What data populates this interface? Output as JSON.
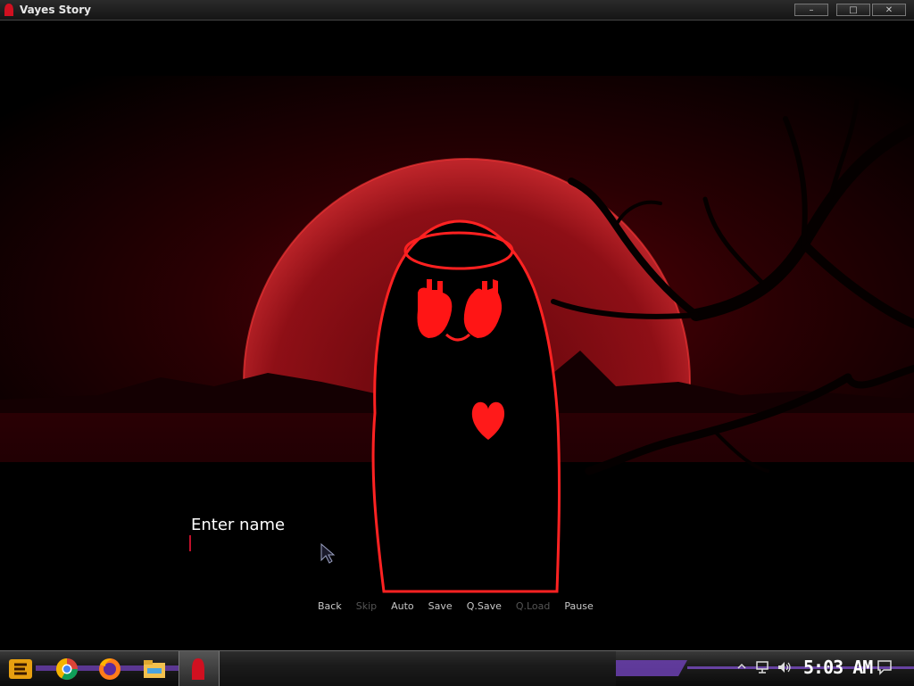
{
  "window": {
    "title": "Vayes Story",
    "minimize_label": "–",
    "maximize_label": "□",
    "close_label": "✕"
  },
  "game": {
    "prompt": "Enter name",
    "name_value": "",
    "quick_menu": [
      {
        "label": "Back",
        "enabled": true
      },
      {
        "label": "Skip",
        "enabled": false
      },
      {
        "label": "Auto",
        "enabled": true
      },
      {
        "label": "Save",
        "enabled": true
      },
      {
        "label": "Q.Save",
        "enabled": true
      },
      {
        "label": "Q.Load",
        "enabled": false
      },
      {
        "label": "Pause",
        "enabled": true
      }
    ]
  },
  "taskbar": {
    "items": [
      "start-menu-icon",
      "chrome-icon",
      "firefox-icon",
      "file-explorer-icon",
      "vayes-story-app-icon"
    ],
    "tray_icons": [
      "show-hidden-icons-chevron",
      "network-icon",
      "volume-icon",
      "action-center-icon"
    ],
    "clock": "5:03 AM"
  },
  "colors": {
    "accent_red": "#e0101e",
    "background": "#000000",
    "moon_red": "#a3121a",
    "taskbar_purple": "#6b3fb0"
  }
}
